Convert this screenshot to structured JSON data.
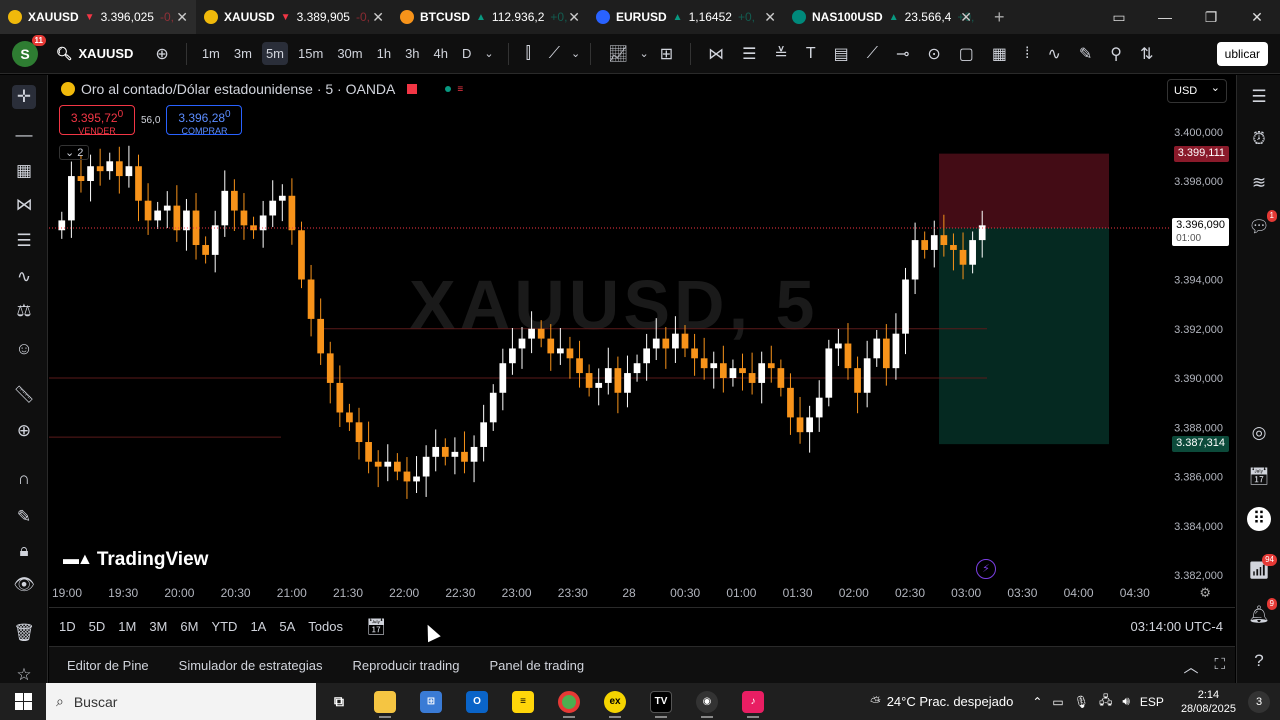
{
  "browser": {
    "tabs": [
      {
        "symbol": "XAUUSD",
        "direction": "▼",
        "price": "3.396,025",
        "change": "-0,",
        "coin_color": "#f0b90b",
        "active": true
      },
      {
        "symbol": "XAUUSD",
        "direction": "▼",
        "price": "3.389,905",
        "change": "-0,",
        "coin_color": "#f0b90b",
        "active": false
      },
      {
        "symbol": "BTCUSD",
        "direction": "▲",
        "price": "112.936,2",
        "change": "+0,",
        "coin_color": "#f7931a",
        "active": false
      },
      {
        "symbol": "EURUSD",
        "direction": "▲",
        "price": "1,16452",
        "change": "+0,",
        "coin_color": "#2962ff",
        "active": false
      },
      {
        "symbol": "NAS100USD",
        "direction": "▲",
        "price": "23.566,4",
        "change": "+0,",
        "coin_color": "#00897b",
        "coin_text": "100",
        "active": false
      }
    ]
  },
  "toolbar": {
    "avatar_letter": "S",
    "avatar_badge": "11",
    "symbol": "XAUUSD",
    "timeframes": [
      "1m",
      "3m",
      "5m",
      "15m",
      "30m",
      "1h",
      "3h",
      "4h",
      "D"
    ],
    "selected_timeframe": "5m",
    "publish_label": "ublicar"
  },
  "chart": {
    "title": "Oro al contado/Dólar estadounidense · 5 · OANDA",
    "sell_price": "3.395,72",
    "sell_sup": "0",
    "sell_label": "VENDER",
    "buy_price": "3.396,28",
    "buy_sup": "0",
    "buy_label": "COMPRAR",
    "spread": "56,0",
    "indicators_collapsed": "2",
    "currency": "USD",
    "watermark": "XAUUSD, 5",
    "logo_text": "TradingView",
    "current_price": "3.396,090",
    "countdown": "01:00",
    "stop_price": "3.399,111",
    "target_price": "3.387,314",
    "colors": {
      "up": "#ffffff",
      "down": "#f7931a",
      "stop_zone": "#4a0d17",
      "target_zone": "#062e25"
    }
  },
  "chart_data": {
    "type": "candlestick",
    "ylim": [
      3382,
      3402
    ],
    "y_ticks": [
      "3.400,000",
      "3.398,000",
      "3.394,000",
      "3.392,000",
      "3.390,000",
      "3.388,000",
      "3.386,000",
      "3.384,000",
      "3.382,000"
    ],
    "y_tick_values": [
      3400,
      3398,
      3394,
      3392,
      3390,
      3388,
      3386,
      3384,
      3382
    ],
    "x_ticks": [
      "19:00",
      "19:30",
      "20:00",
      "20:30",
      "21:00",
      "21:30",
      "22:00",
      "22:30",
      "23:00",
      "23:30",
      "28",
      "00:30",
      "01:00",
      "01:30",
      "02:00",
      "02:30",
      "03:00",
      "03:30",
      "04:00",
      "04:30"
    ],
    "close_series_approx": [
      3396.4,
      3398.2,
      3398.0,
      3398.6,
      3398.4,
      3398.8,
      3398.2,
      3398.6,
      3397.2,
      3396.4,
      3396.8,
      3397.0,
      3396.0,
      3396.8,
      3395.4,
      3395.0,
      3396.2,
      3397.6,
      3396.8,
      3396.2,
      3396.0,
      3396.6,
      3397.2,
      3397.4,
      3396.0,
      3394.0,
      3392.4,
      3391.0,
      3389.8,
      3388.6,
      3388.2,
      3387.4,
      3386.6,
      3386.4,
      3386.6,
      3386.2,
      3385.8,
      3386.0,
      3386.8,
      3387.2,
      3386.8,
      3387.0,
      3386.6,
      3387.2,
      3388.2,
      3389.4,
      3390.6,
      3391.2,
      3391.6,
      3392.0,
      3391.6,
      3391.0,
      3391.2,
      3390.8,
      3390.2,
      3389.6,
      3389.8,
      3390.4,
      3389.4,
      3390.2,
      3390.6,
      3391.2,
      3391.6,
      3391.2,
      3391.8,
      3391.2,
      3390.8,
      3390.4,
      3390.6,
      3390.0,
      3390.4,
      3390.2,
      3389.8,
      3390.6,
      3390.4,
      3389.6,
      3388.4,
      3387.8,
      3388.4,
      3389.2,
      3391.2,
      3391.4,
      3390.4,
      3389.4,
      3390.8,
      3391.6,
      3390.4,
      3391.8,
      3394.0,
      3395.6,
      3395.2,
      3395.8,
      3395.4,
      3395.2,
      3394.6,
      3395.6,
      3396.2
    ],
    "current_price": 3396.09,
    "horizontal_lines": [
      3396.09,
      3392.0,
      3390.0,
      3387.6
    ],
    "position": {
      "type": "short",
      "entry": 3396.09,
      "stop": 3399.111,
      "target": 3387.314,
      "start_time": "02:30",
      "end_time": "04:00"
    }
  },
  "range_bar": {
    "ranges": [
      "1D",
      "5D",
      "1M",
      "3M",
      "6M",
      "YTD",
      "1A",
      "5A",
      "Todos"
    ],
    "clock": "03:14:00 UTC-4"
  },
  "panels": [
    "Editor de Pine",
    "Simulador de estrategias",
    "Reproducir trading",
    "Panel de trading"
  ],
  "right_badges": {
    "chat": "1",
    "feed": "94",
    "alerts": "9"
  },
  "taskbar": {
    "search_placeholder": "Buscar",
    "weather": "24°C  Prac. despejado",
    "lang": "ESP",
    "time": "2:14",
    "date": "28/08/2025",
    "notifications": "3"
  }
}
